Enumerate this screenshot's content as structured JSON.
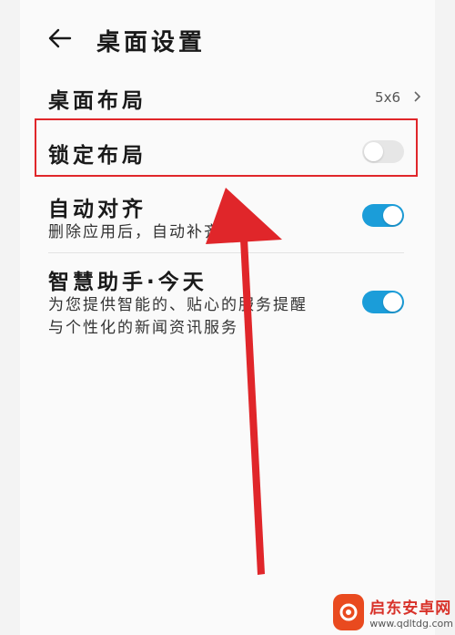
{
  "header": {
    "back_icon": "arrow-left-icon",
    "title": "桌面设置"
  },
  "settings": {
    "desktop_layout": {
      "label": "桌面布局",
      "value": "5x6",
      "chevron_icon": "chevron-right-icon"
    },
    "lock_layout": {
      "label": "锁定布局",
      "enabled": false
    },
    "auto_align": {
      "label": "自动对齐",
      "description": "删除应用后，自动补齐空位",
      "enabled": true
    },
    "smart_assistant": {
      "label": "智慧助手·今天",
      "description_line1": "为您提供智能的、贴心的服务提醒",
      "description_line2": "与个性化的新闻资讯服务",
      "enabled": true
    }
  },
  "colors": {
    "toggle_on": "#1b9dd9",
    "toggle_off": "#e6e6e6",
    "highlight_box": "#e0262a",
    "arrow": "#e0262a"
  },
  "watermark": {
    "name": "启东安卓网",
    "url": "www.qdltdg.com"
  }
}
